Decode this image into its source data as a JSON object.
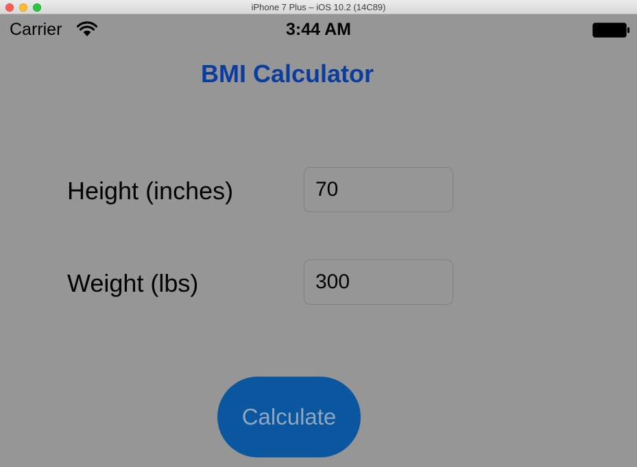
{
  "window": {
    "title": "iPhone 7 Plus – iOS 10.2 (14C89)"
  },
  "status_bar": {
    "carrier": "Carrier",
    "time": "3:44 AM",
    "icons": [
      "wifi-icon",
      "battery-icon"
    ]
  },
  "app": {
    "title": "BMI Calculator",
    "height_label": "Height (inches)",
    "height_value": "70",
    "weight_label": "Weight (lbs)",
    "weight_value": "300",
    "calculate_label": "Calculate"
  },
  "colors": {
    "background": "#969696",
    "title": "#0a3d9e",
    "button": "#0a579f",
    "button_text": "#8fa6c0"
  }
}
